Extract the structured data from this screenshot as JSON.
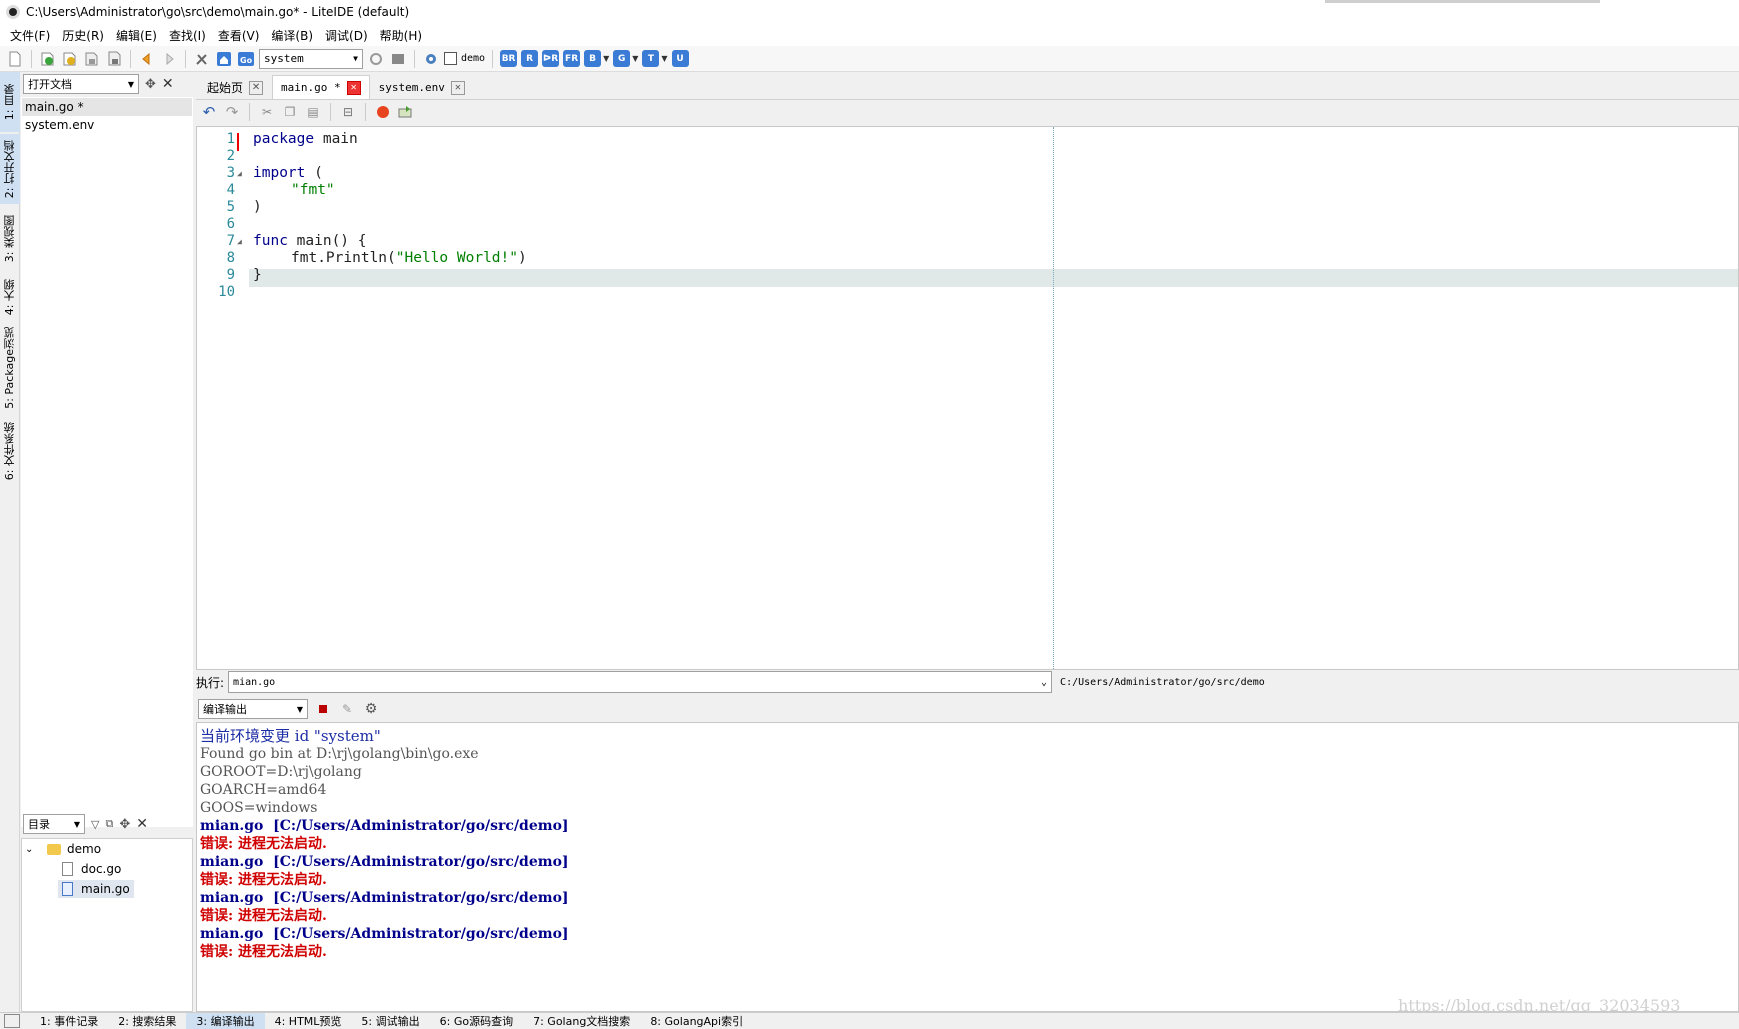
{
  "window": {
    "title": "C:\\Users\\Administrator\\go\\src\\demo\\main.go* - LiteIDE (default)"
  },
  "menu": [
    "文件(F)",
    "历史(R)",
    "编辑(E)",
    "查找(I)",
    "查看(V)",
    "编译(B)",
    "调试(D)",
    "帮助(H)"
  ],
  "toolbar": {
    "env_value": "system",
    "demo_checkbox_label": "demo",
    "build_buttons": [
      "BR",
      "R",
      "ᐅR",
      "FR",
      "B",
      "G",
      "T",
      "U"
    ]
  },
  "side_tabs": [
    "1: 目录",
    "2: 打开文档",
    "3: 类视图",
    "4: 大纲",
    "5: Package浏览",
    "6: 文件系统"
  ],
  "open_docs": {
    "header": "打开文档",
    "items": [
      "main.go *",
      "system.env"
    ]
  },
  "dir_panel": {
    "header": "目录",
    "root": "demo",
    "files": [
      "doc.go",
      "main.go"
    ]
  },
  "editor": {
    "tabs": [
      {
        "label": "起始页",
        "active": false
      },
      {
        "label": "main.go *",
        "active": true
      },
      {
        "label": "system.env",
        "active": false
      }
    ],
    "line_numbers": [
      "1",
      "2",
      "3",
      "4",
      "5",
      "6",
      "7",
      "8",
      "9",
      "10"
    ],
    "code": {
      "l1": [
        "package",
        " main"
      ],
      "l3": [
        "import",
        " ("
      ],
      "l4": "\"fmt\"",
      "l5": ")",
      "l7": [
        "func",
        " main() {"
      ],
      "l8": [
        "fmt.Println(",
        "\"Hello World!\"",
        ")"
      ],
      "l9": "}"
    }
  },
  "run": {
    "label": "执行:",
    "command": "mian.go",
    "path": "C:/Users/Administrator/go/src/demo"
  },
  "output": {
    "selector": "编译输出",
    "lines": [
      {
        "type": "info",
        "text": "当前环境变更 id \"system\""
      },
      {
        "type": "plain",
        "text": "Found go bin at D:\\rj\\golang\\bin\\go.exe"
      },
      {
        "type": "plain",
        "text": "GOROOT=D:\\rj\\golang"
      },
      {
        "type": "plain",
        "text": "GOARCH=amd64"
      },
      {
        "type": "plain",
        "text": "GOOS=windows"
      },
      {
        "type": "file",
        "text": "mian.go  [C:/Users/Administrator/go/src/demo]"
      },
      {
        "type": "err",
        "text": "错误: 进程无法启动."
      },
      {
        "type": "file",
        "text": "mian.go  [C:/Users/Administrator/go/src/demo]"
      },
      {
        "type": "err",
        "text": "错误: 进程无法启动."
      },
      {
        "type": "file",
        "text": "mian.go  [C:/Users/Administrator/go/src/demo]"
      },
      {
        "type": "err",
        "text": "错误: 进程无法启动."
      },
      {
        "type": "file",
        "text": "mian.go  [C:/Users/Administrator/go/src/demo]"
      },
      {
        "type": "err",
        "text": "错误: 进程无法启动."
      }
    ]
  },
  "status_tabs": [
    {
      "label": "1: 事件记录",
      "active": false
    },
    {
      "label": "2: 搜索结果",
      "active": false
    },
    {
      "label": "3: 编译输出",
      "active": true
    },
    {
      "label": "4: HTML预览",
      "active": false
    },
    {
      "label": "5: 调试输出",
      "active": false
    },
    {
      "label": "6: Go源码查询",
      "active": false
    },
    {
      "label": "7: Golang文档搜索",
      "active": false
    },
    {
      "label": "8: GolangApi索引",
      "active": false
    }
  ],
  "watermark": "https://blog.csdn.net/qq_32034593",
  "colors": {
    "accent": "#3a7bd5",
    "error": "#d00000",
    "file": "#00008b",
    "info": "#1c2ea5"
  }
}
